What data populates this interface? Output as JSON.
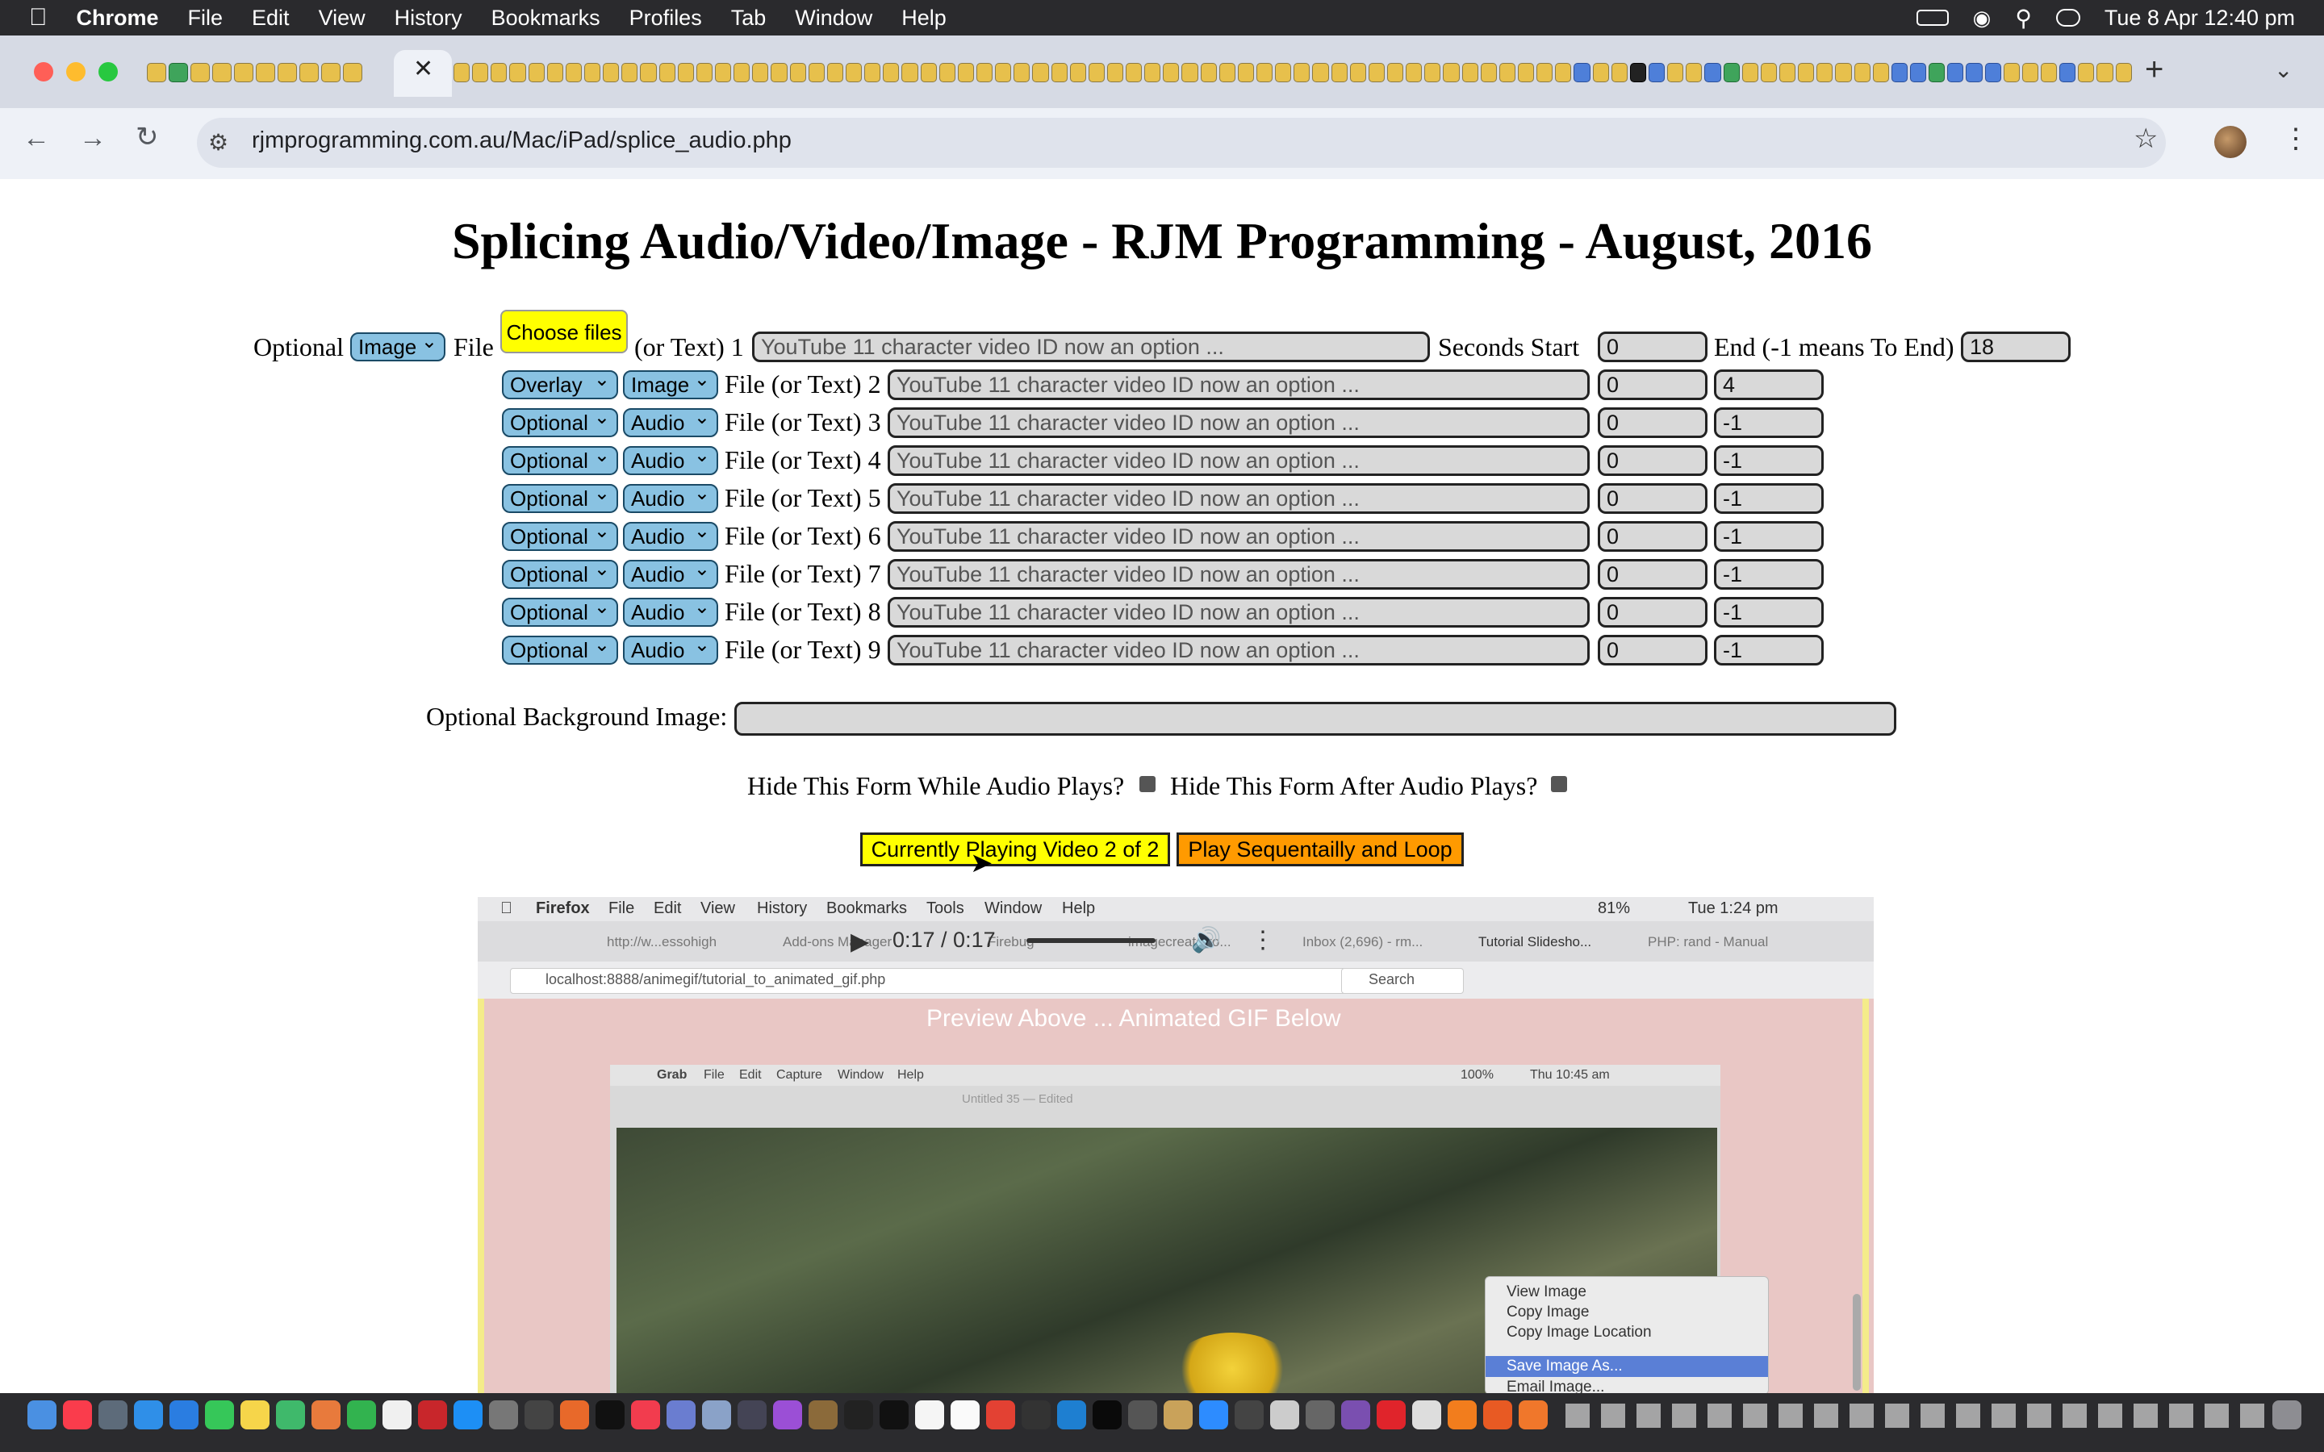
{
  "menubar": {
    "app": "Chrome",
    "items": [
      "File",
      "Edit",
      "View",
      "History",
      "Bookmarks",
      "Profiles",
      "Tab",
      "Window",
      "Help"
    ],
    "clock": "Tue 8 Apr  12:40 pm"
  },
  "browser": {
    "url": "rjmprogramming.com.au/Mac/iPad/splice_audio.php",
    "new_tab": "+",
    "close_tab": "✕"
  },
  "page": {
    "title": "Splicing Audio/Video/Image - RJM Programming - August, 2016",
    "row1": {
      "optional_label": "Optional",
      "type_select": "Image",
      "file_label": "File",
      "choose_button": "Choose files",
      "or_text_label": "(or Text) 1",
      "placeholder": "YouTube 11 character video ID now an option ...",
      "seconds_start_label": "Seconds Start",
      "start": "0",
      "end_label": "End (-1 means To End)",
      "end": "18"
    },
    "rows": [
      {
        "mode": "Overlay",
        "type": "Image",
        "label": "File (or Text) 2",
        "placeholder": "YouTube 11 character video ID now an option ...",
        "start": "0",
        "end": "4"
      },
      {
        "mode": "Optional",
        "type": "Audio",
        "label": "File (or Text) 3",
        "placeholder": "YouTube 11 character video ID now an option ...",
        "start": "0",
        "end": "-1"
      },
      {
        "mode": "Optional",
        "type": "Audio",
        "label": "File (or Text) 4",
        "placeholder": "YouTube 11 character video ID now an option ...",
        "start": "0",
        "end": "-1"
      },
      {
        "mode": "Optional",
        "type": "Audio",
        "label": "File (or Text) 5",
        "placeholder": "YouTube 11 character video ID now an option ...",
        "start": "0",
        "end": "-1"
      },
      {
        "mode": "Optional",
        "type": "Audio",
        "label": "File (or Text) 6",
        "placeholder": "YouTube 11 character video ID now an option ...",
        "start": "0",
        "end": "-1"
      },
      {
        "mode": "Optional",
        "type": "Audio",
        "label": "File (or Text) 7",
        "placeholder": "YouTube 11 character video ID now an option ...",
        "start": "0",
        "end": "-1"
      },
      {
        "mode": "Optional",
        "type": "Audio",
        "label": "File (or Text) 8",
        "placeholder": "YouTube 11 character video ID now an option ...",
        "start": "0",
        "end": "-1"
      },
      {
        "mode": "Optional",
        "type": "Audio",
        "label": "File (or Text) 9",
        "placeholder": "YouTube 11 character video ID now an option ...",
        "start": "0",
        "end": "-1"
      }
    ],
    "background_label": "Optional Background Image:",
    "background_value": "",
    "hide_while_label": "Hide This Form While Audio Plays?",
    "hide_after_label": "Hide This Form After Audio Plays?",
    "playing_button": "Currently Playing Video 2 of 2",
    "loop_button": "Play Sequentailly and Loop"
  },
  "video": {
    "time": "0:17 / 0:17",
    "overlay_caption": "Preview Above ... Animated GIF Below",
    "inner_menubar": {
      "app": "Firefox",
      "items": [
        "File",
        "Edit",
        "View",
        "History",
        "Bookmarks",
        "Tools",
        "Window",
        "Help"
      ],
      "status": "81%",
      "clock": "Tue 1:24 pm"
    },
    "inner_tabs": [
      "http://w...essohigh",
      "Add-ons Manager",
      "Firebug",
      "imagecreatefro...",
      "Inbox (2,696) - rm...",
      "Tutorial Slidesho...",
      "PHP: rand - Manual"
    ],
    "inner_url": "localhost:8888/animegif/tutorial_to_animated_gif.php",
    "inner_search": "Search",
    "grab_menubar": {
      "app": "Grab",
      "items": [
        "File",
        "Edit",
        "Capture",
        "Window",
        "Help"
      ],
      "status": "100%",
      "clock": "Thu 10:45 am"
    },
    "grab_doc_title": "Untitled 35 — Edited",
    "context_menu": [
      "View Image",
      "Copy Image",
      "Copy Image Location",
      "Save Image As...",
      "Email Image..."
    ]
  },
  "colors": {
    "accent_select": "#89c2e2",
    "yellow_button": "#ffff00",
    "orange_button": "#ff9a00",
    "menubar": "#2a2a2d"
  }
}
